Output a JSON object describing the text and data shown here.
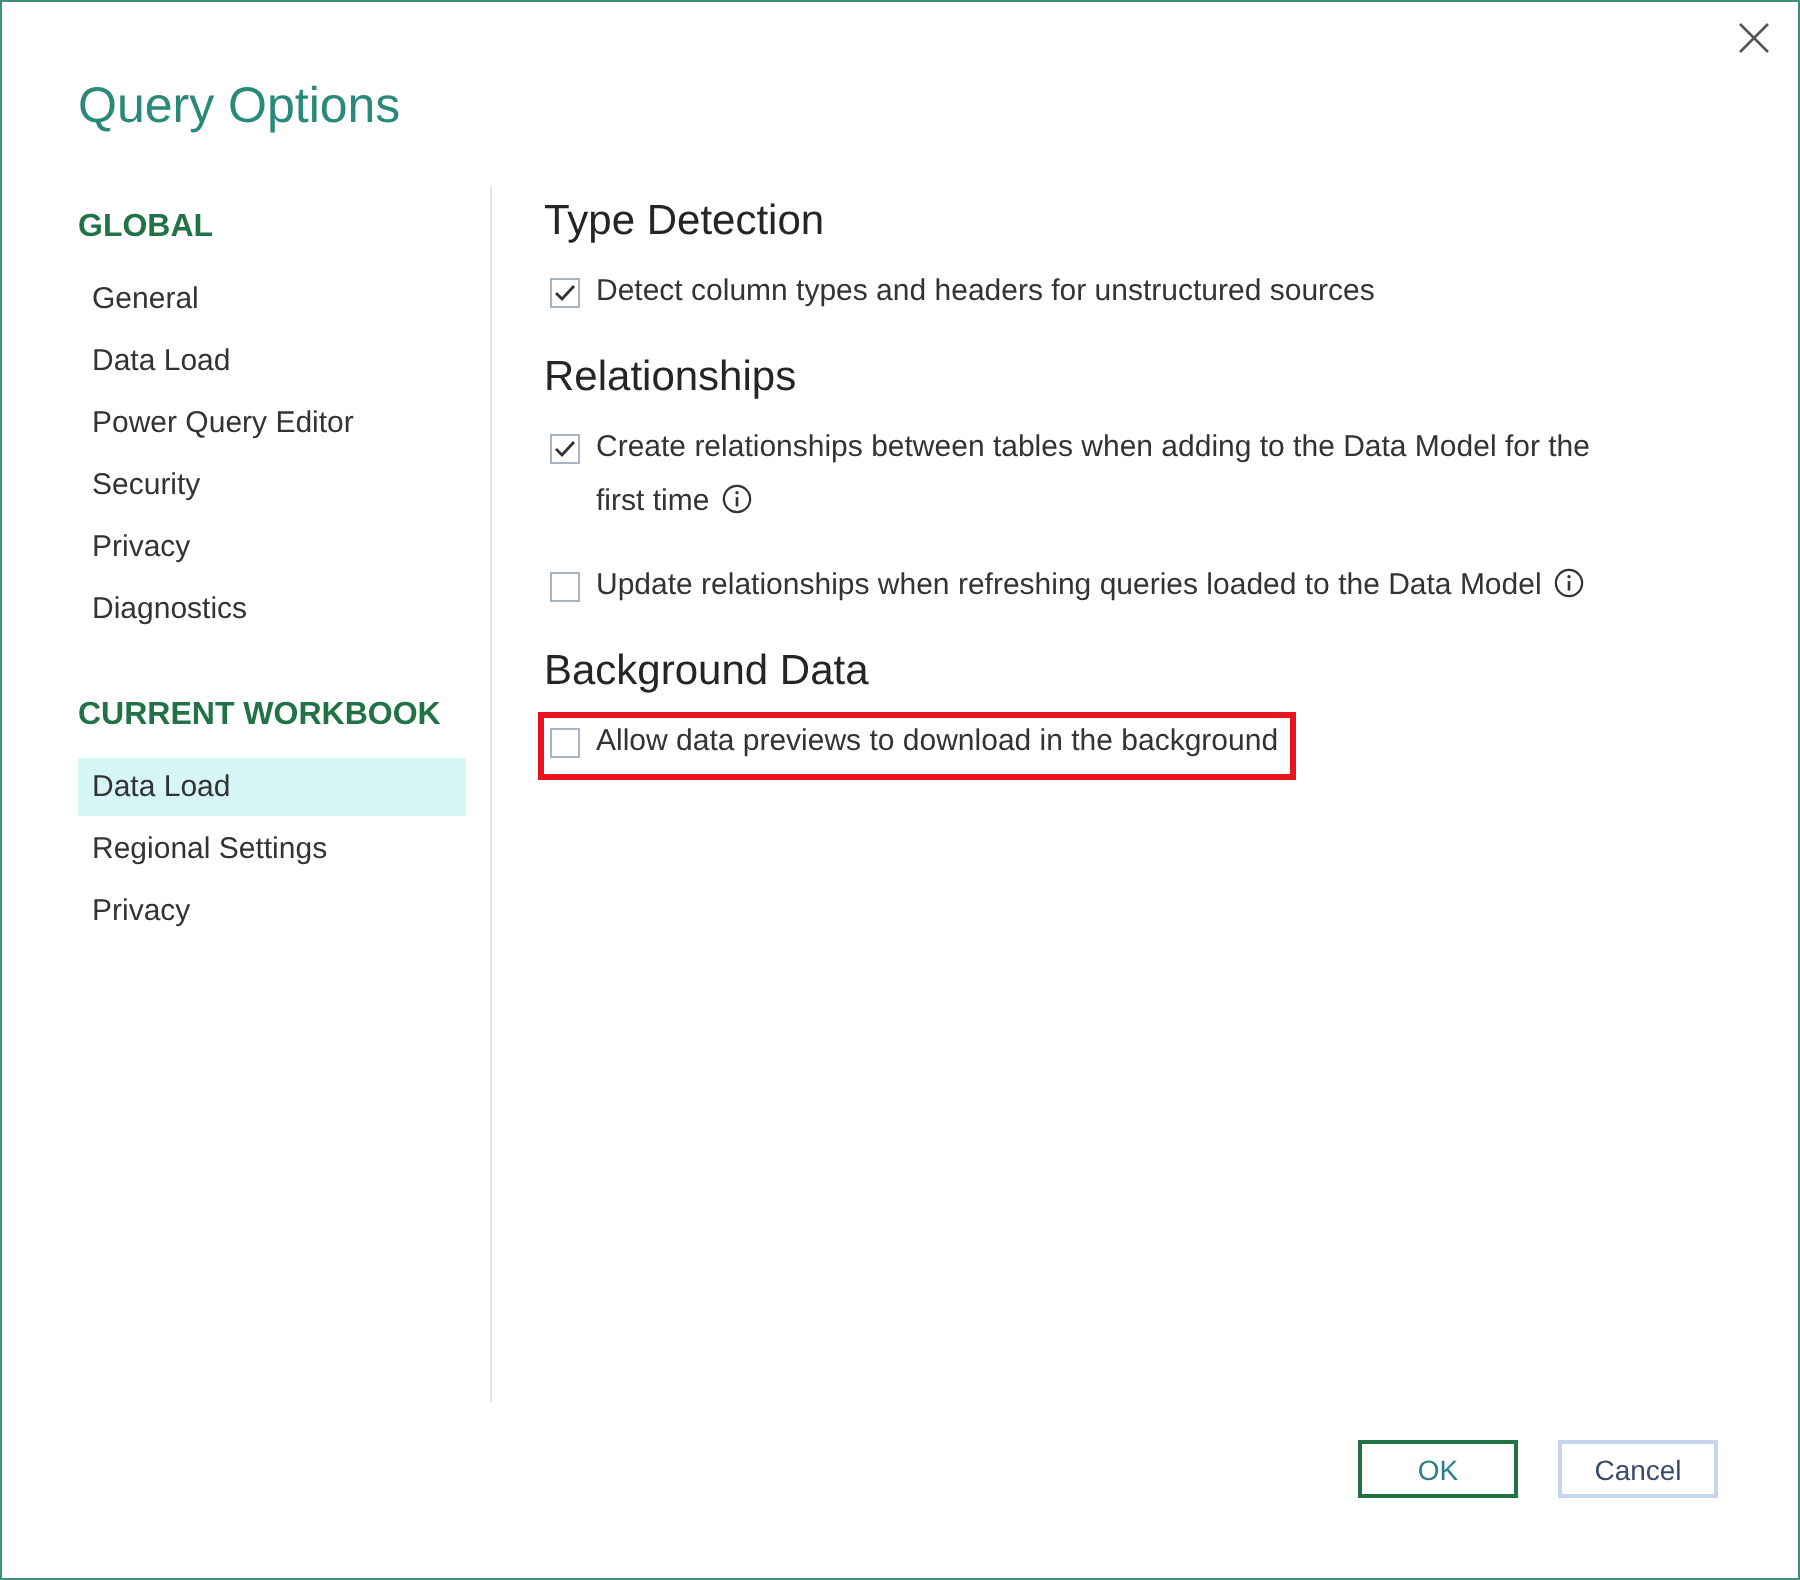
{
  "window": {
    "title": "Query Options"
  },
  "sidebar": {
    "sections": [
      {
        "heading": "GLOBAL",
        "items": [
          {
            "label": "General",
            "selected": false
          },
          {
            "label": "Data Load",
            "selected": false
          },
          {
            "label": "Power Query Editor",
            "selected": false
          },
          {
            "label": "Security",
            "selected": false
          },
          {
            "label": "Privacy",
            "selected": false
          },
          {
            "label": "Diagnostics",
            "selected": false
          }
        ]
      },
      {
        "heading": "CURRENT WORKBOOK",
        "items": [
          {
            "label": "Data Load",
            "selected": true
          },
          {
            "label": "Regional Settings",
            "selected": false
          },
          {
            "label": "Privacy",
            "selected": false
          }
        ]
      }
    ]
  },
  "groups": [
    {
      "heading": "Type Detection",
      "options": [
        {
          "label": "Detect column types and headers for unstructured sources",
          "checked": true,
          "info": false,
          "highlighted": false
        }
      ]
    },
    {
      "heading": "Relationships",
      "options": [
        {
          "label": "Create relationships between tables when adding to the Data Model for the first time",
          "checked": true,
          "info": true,
          "highlighted": false
        },
        {
          "label": "Update relationships when refreshing queries loaded to the Data Model",
          "checked": false,
          "info": true,
          "highlighted": false
        }
      ]
    },
    {
      "heading": "Background Data",
      "options": [
        {
          "label": "Allow data previews to download in the background",
          "checked": false,
          "info": false,
          "highlighted": true
        }
      ]
    }
  ],
  "buttons": [
    {
      "label": "OK",
      "kind": "primary"
    },
    {
      "label": "Cancel",
      "kind": "secondary"
    }
  ]
}
